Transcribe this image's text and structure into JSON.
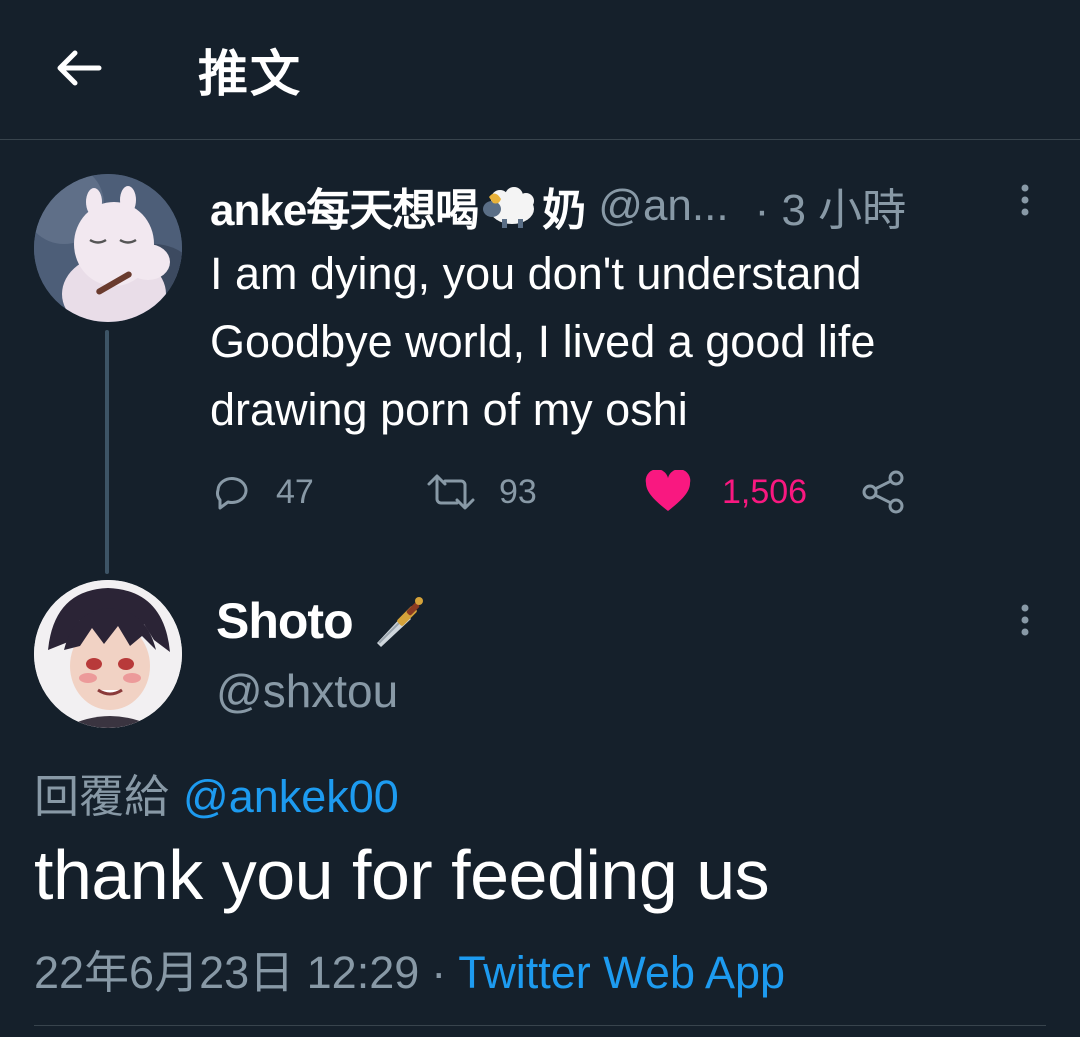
{
  "header": {
    "title": "推文",
    "back_icon": "arrow-left-icon"
  },
  "parent_tweet": {
    "display_name_prefix": "anke每天想喝",
    "display_name_suffix": "奶",
    "name_emoji": "sheep-emoji",
    "handle": "@an...",
    "time": "· 3 小時",
    "text_lines": [
      "I am dying, you don't understand",
      "Goodbye world, I lived a good life",
      "drawing porn of my oshi"
    ],
    "replies": "47",
    "retweets": "93",
    "likes": "1,506",
    "liked": true
  },
  "reply_tweet": {
    "display_name": "Shoto",
    "name_emoji": "dagger-emoji",
    "handle": "@shxtou",
    "reply_to_label": "回覆給",
    "reply_to_handle": "@ankek00",
    "text": "thank you for feeding us",
    "timestamp": "22年6月23日 12:29",
    "separator": "·",
    "source": "Twitter Web App"
  },
  "colors": {
    "background": "#15202b",
    "secondary_text": "#8899a6",
    "link": "#1d9bf0",
    "like": "#f91880",
    "divider": "#38444d"
  }
}
